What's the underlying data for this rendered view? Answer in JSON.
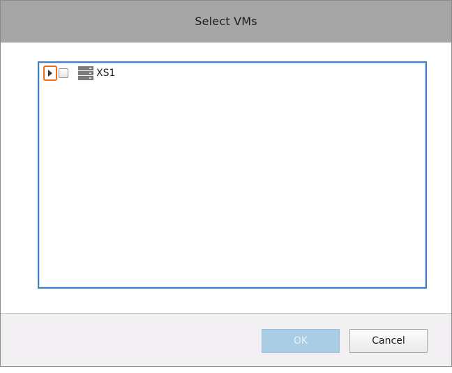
{
  "dialog": {
    "title": "Select VMs"
  },
  "tree": {
    "nodes": [
      {
        "label": "XS1",
        "icon": "server-icon",
        "expanded": false,
        "checked": false
      }
    ]
  },
  "buttons": {
    "ok_label": "OK",
    "ok_enabled": false,
    "cancel_label": "Cancel"
  },
  "colors": {
    "titlebar": "#a6a6a6",
    "tree_border": "#3f7fc1",
    "highlight": "#ef6b18",
    "ok_disabled": "#a9cde5",
    "footer": "#f2f0f2"
  }
}
